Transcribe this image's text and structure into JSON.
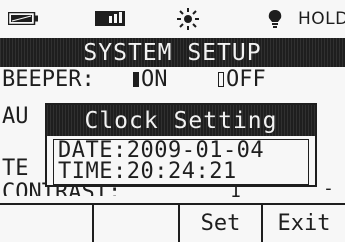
{
  "status_bar": {
    "battery_icon": "battery-icon",
    "signal_icon": "signal-icon",
    "backlight_icon": "sun-icon",
    "light_icon": "bulb-icon",
    "hold_label": "HOLD"
  },
  "screen": {
    "title": "SYSTEM SETUP",
    "beeper_label": "BEEPER:",
    "beeper_on": "ON",
    "beeper_off": "OFF",
    "beeper_selected": "ON",
    "auto_partial": "AU",
    "te_partial": "TE",
    "contrast_partial": "CONTRAST:",
    "contrast_value_partial": "1",
    "contrast_dash": "-"
  },
  "popup": {
    "title": "Clock Setting",
    "date_line": "DATE:2009-01-04",
    "time_line": "TIME:20:24:21"
  },
  "softkeys": [
    "",
    "",
    "Set",
    "Exit"
  ],
  "colors": {
    "lcd_background": "#f7f7f7",
    "lcd_foreground": "#1e1e1e",
    "inverse_text": "#f2f2f2"
  }
}
